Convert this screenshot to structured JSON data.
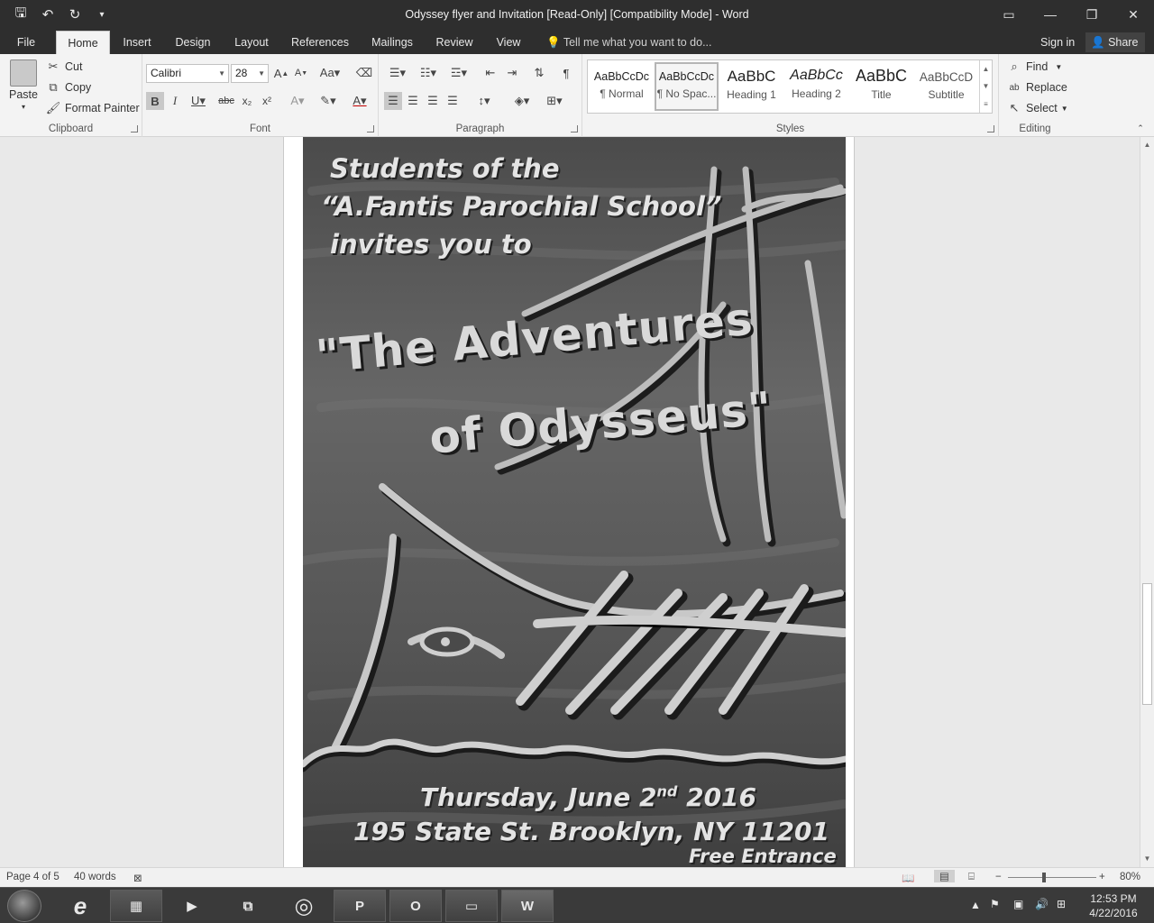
{
  "window": {
    "title": "Odyssey flyer and Invitation [Read-Only] [Compatibility Mode] - Word",
    "qat": [
      {
        "name": "save-icon",
        "glyph": "🖫"
      },
      {
        "name": "undo-icon",
        "glyph": "↶"
      },
      {
        "name": "redo-icon",
        "glyph": "↻"
      },
      {
        "name": "customize-qat-icon",
        "glyph": "≡"
      }
    ],
    "controls": [
      "▭",
      "—",
      "❐",
      "✕"
    ]
  },
  "tabs": [
    "File",
    "Home",
    "Insert",
    "Design",
    "Layout",
    "References",
    "Mailings",
    "Review",
    "View"
  ],
  "active_tab": "Home",
  "tellme": "Tell me what you want to do...",
  "signin": "Sign in",
  "share": "Share",
  "ribbon": {
    "clipboard": {
      "label": "Clipboard",
      "paste": "Paste",
      "cut": "Cut",
      "copy": "Copy",
      "format_painter": "Format Painter"
    },
    "font": {
      "label": "Font",
      "name": "Calibri",
      "size": "28"
    },
    "paragraph": {
      "label": "Paragraph"
    },
    "styles": {
      "label": "Styles",
      "items": [
        {
          "sample": "AaBbCcDc",
          "name": "¶ Normal"
        },
        {
          "sample": "AaBbCcDc",
          "name": "¶ No Spac..."
        },
        {
          "sample": "AaBbC",
          "name": "Heading 1"
        },
        {
          "sample": "AaBbCc",
          "name": "Heading 2"
        },
        {
          "sample": "AaBbC",
          "name": "Title"
        },
        {
          "sample": "AaBbCcD",
          "name": "Subtitle"
        }
      ],
      "selected_index": 1
    },
    "editing": {
      "label": "Editing",
      "find": "Find",
      "replace": "Replace",
      "select": "Select"
    }
  },
  "flyer": {
    "line1": "Students of the",
    "line2": "“A.Fantis Parochial School”",
    "line3": "invites you to",
    "title1": "\"The Adventures",
    "title2": "of Odysseus\"",
    "date_main": "Thursday, June 2",
    "date_sup": "nd",
    "date_year": "2016",
    "address": "195 State St. Brooklyn, NY 11201",
    "entrance": "Free Entrance"
  },
  "status": {
    "page": "Page 4 of 5",
    "words": "40 words",
    "zoom": "80%",
    "zoom_fraction": 0.4
  },
  "tray": {
    "time": "12:53 PM",
    "date": "4/22/2016"
  }
}
